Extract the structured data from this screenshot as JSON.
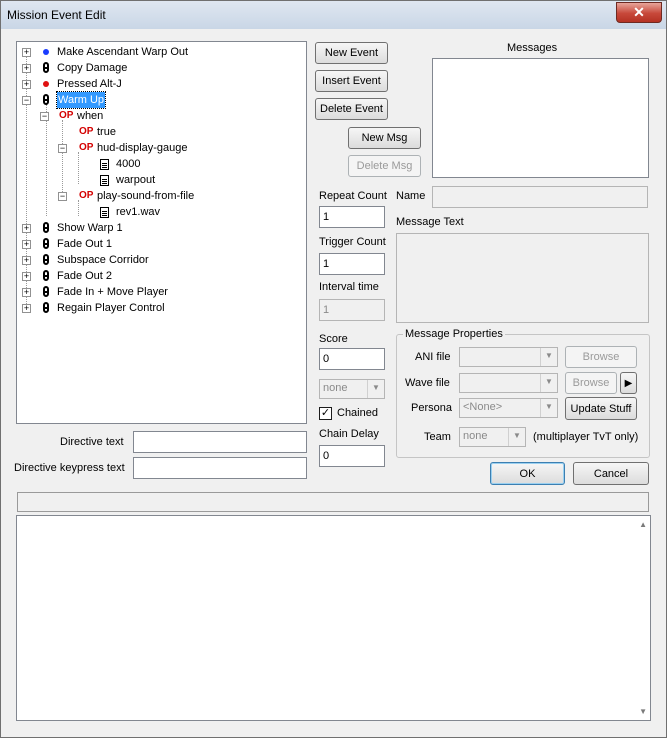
{
  "window": {
    "title": "Mission Event Edit",
    "close_glyph": "✕"
  },
  "tree": {
    "expand_glyph": "+",
    "collapse_glyph": "−",
    "op_glyph": "OP",
    "events": [
      {
        "label": "Make Ascendant Warp Out",
        "icon": "blue-dot-icon",
        "icon_color": "#1a3cff"
      },
      {
        "label": "Copy Damage",
        "icon": "chain-icon"
      },
      {
        "label": "Pressed Alt-J",
        "icon": "red-dot-icon",
        "icon_color": "#e01010"
      },
      {
        "label": "Warm Up",
        "icon": "chain-icon"
      },
      {
        "label": "Show Warp 1",
        "icon": "chain-icon"
      },
      {
        "label": "Fade Out 1",
        "icon": "chain-icon"
      },
      {
        "label": "Subspace Corridor",
        "icon": "chain-icon"
      },
      {
        "label": "Fade Out 2",
        "icon": "chain-icon"
      },
      {
        "label": "Fade In + Move Player",
        "icon": "chain-icon"
      },
      {
        "label": "Regain Player Control",
        "icon": "chain-icon"
      }
    ],
    "warm_up_children": {
      "when": "when",
      "true": "true",
      "hud": "hud-display-gauge",
      "hud_arg1": "4000",
      "hud_arg2": "warpout",
      "sound": "play-sound-from-file",
      "sound_arg": "rev1.wav"
    }
  },
  "buttons": {
    "new_event": "New Event",
    "insert_event": "Insert Event",
    "delete_event": "Delete Event",
    "new_msg": "New Msg",
    "delete_msg": "Delete Msg",
    "browse_ani": "Browse",
    "browse_wave": "Browse",
    "play_glyph": "▶",
    "update_stuff": "Update Stuff",
    "ok": "OK",
    "cancel": "Cancel"
  },
  "fields": {
    "repeat_count_label": "Repeat Count",
    "repeat_count": "1",
    "trigger_count_label": "Trigger Count",
    "trigger_count": "1",
    "interval_time_label": "Interval time",
    "interval_time": "1",
    "score_label": "Score",
    "score": "0",
    "team_dropdown": "none",
    "chained_label": "Chained",
    "chained_check": "✓",
    "chain_delay_label": "Chain Delay",
    "chain_delay": "0",
    "directive_text_label": "Directive text",
    "directive_text": "",
    "directive_keypress_label": "Directive keypress text",
    "directive_keypress": ""
  },
  "messages": {
    "title": "Messages",
    "name_label": "Name",
    "name_value": "",
    "message_text_label": "Message Text",
    "properties_title": "Message Properties",
    "ani_file_label": "ANI file",
    "wave_file_label": "Wave file",
    "persona_label": "Persona",
    "persona_value": "<None>",
    "team_label": "Team",
    "team_value": "none",
    "team_note": "(multiplayer TvT only)"
  },
  "dropdown_arrow": "▼",
  "scroll_up": "▲",
  "scroll_down": "▼"
}
